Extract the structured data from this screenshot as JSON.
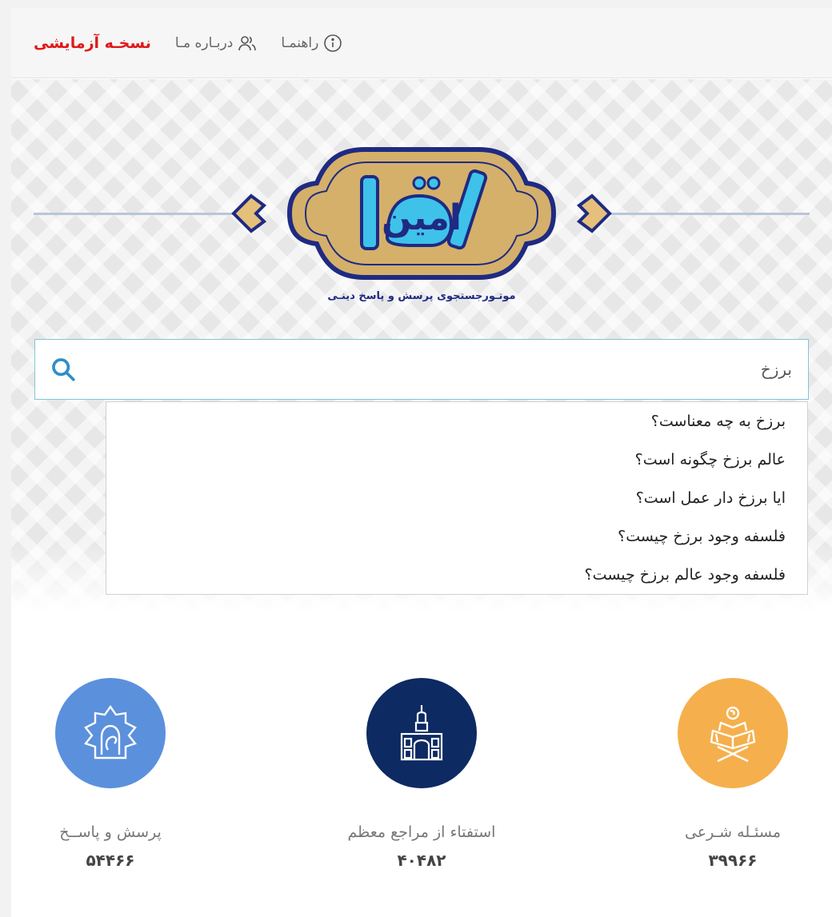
{
  "header": {
    "brand": "نسخـه آزمایشی",
    "about_label": "دربـاره مـا",
    "help_label": "راهنمـا"
  },
  "logo": {
    "wordmark": "امین",
    "tagline": "موتـورجستجوی پرسش و پاسخ دینـی"
  },
  "search": {
    "value": "برزخ"
  },
  "suggestions": [
    "برزخ به چه معناست؟",
    "عالم برزخ چگونه است؟",
    "ایا برزخ دار عمل است؟",
    "فلسفه وجود برزخ چیست؟",
    "فلسفه وجود عالم برزخ چیست؟"
  ],
  "stats": [
    {
      "label": "پرسش و پاســخ",
      "value": "۵۴۴۶۶",
      "icon": "qa-mosque-icon",
      "color": "#5b90dd"
    },
    {
      "label": "استفتاء از مراجع معظم",
      "value": "۴۰۴۸۲",
      "icon": "shrine-icon",
      "color": "#0d2a63"
    },
    {
      "label": "مسئـله شـرعی",
      "value": "۳۹۹۶۶",
      "icon": "quran-icon",
      "color": "#f5b04d"
    }
  ]
}
